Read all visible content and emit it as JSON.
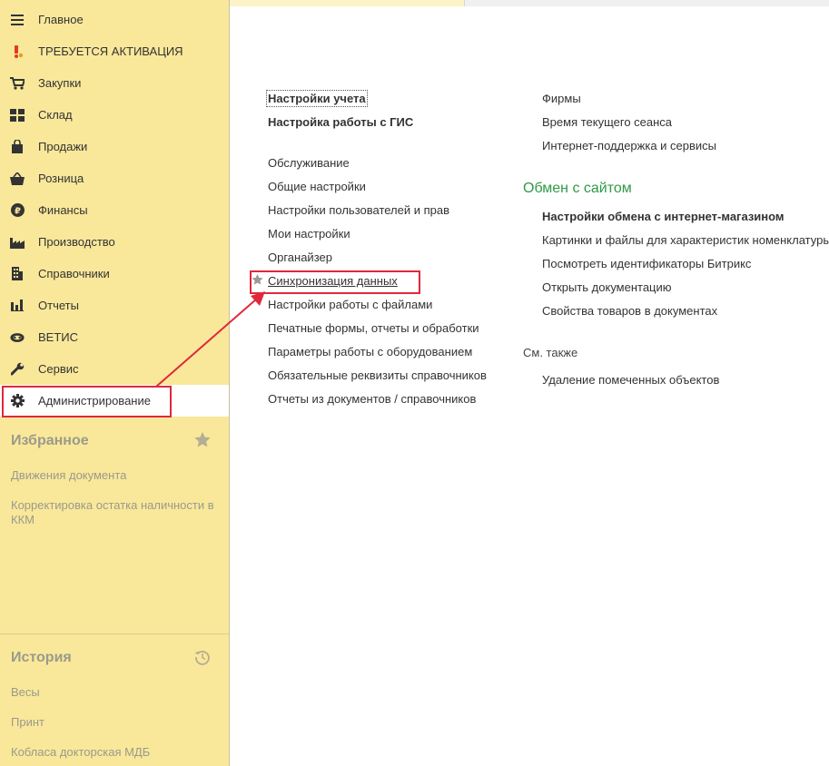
{
  "sidebar": {
    "items": [
      {
        "label": "Главное",
        "icon": "menu-icon"
      },
      {
        "label": "ТРЕБУЕТСЯ АКТИВАЦИЯ",
        "icon": "warning-icon"
      },
      {
        "label": "Закупки",
        "icon": "cart-icon"
      },
      {
        "label": "Склад",
        "icon": "warehouse-icon"
      },
      {
        "label": "Продажи",
        "icon": "shopping-bag-icon"
      },
      {
        "label": "Розница",
        "icon": "basket-icon"
      },
      {
        "label": "Финансы",
        "icon": "ruble-icon"
      },
      {
        "label": "Производство",
        "icon": "factory-icon"
      },
      {
        "label": "Справочники",
        "icon": "building-icon"
      },
      {
        "label": "Отчеты",
        "icon": "bar-chart-icon"
      },
      {
        "label": "ВЕТИС",
        "icon": "cow-icon"
      },
      {
        "label": "Сервис",
        "icon": "wrench-icon"
      },
      {
        "label": "Администрирование",
        "icon": "gear-icon"
      }
    ],
    "favorites": {
      "title": "Избранное",
      "items": [
        "Движения документа",
        "Корректировка остатка наличности в ККМ"
      ]
    },
    "history": {
      "title": "История",
      "items": [
        "Весы",
        "Принт",
        "Кобласа докторская МДБ"
      ]
    }
  },
  "main": {
    "col1": {
      "settings": "Настройки учета",
      "gis": "Настройка работы с ГИС",
      "links": [
        "Обслуживание",
        "Общие настройки",
        "Настройки пользователей и прав",
        "Мои настройки",
        "Органайзер",
        "Синхронизация данных",
        "Настройки работы с файлами",
        "Печатные формы, отчеты и обработки",
        "Параметры работы с оборудованием",
        "Обязательные реквизиты справочников",
        "Отчеты из документов / справочников"
      ]
    },
    "col2": {
      "links": [
        "Фирмы",
        "Время текущего сеанса",
        "Интернет-поддержка и сервисы"
      ],
      "exchange_title": "Обмен с сайтом",
      "exchange_links": [
        "Настройки обмена с интернет-магазином",
        "Картинки и файлы для характеристик номенклатуры",
        "Посмотреть идентификаторы Битрикс",
        "Открыть документацию",
        "Свойства товаров в документах"
      ],
      "see_also_title": "См. также",
      "see_also_links": [
        "Удаление помеченных объектов"
      ]
    }
  },
  "colors": {
    "sidebar": "#f9e89a",
    "highlight": "#e0283a",
    "section_green": "#2f9a46"
  }
}
